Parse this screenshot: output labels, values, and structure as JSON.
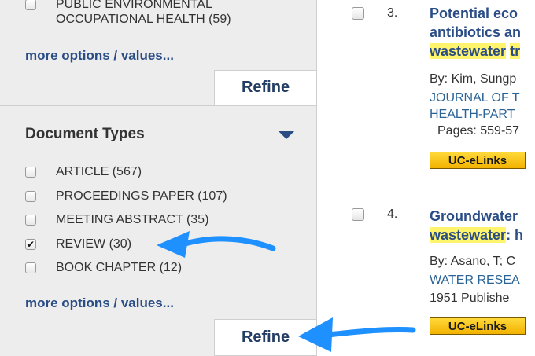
{
  "sidebar": {
    "prev_facet_item": {
      "label": "PUBLIC ENVIRONMENTAL\nOCCUPATIONAL HEALTH (59)"
    },
    "prev_more_options": "more options / values...",
    "prev_refine": "Refine",
    "doc_types": {
      "heading": "Document Types",
      "items": [
        {
          "label": "ARTICLE (567)",
          "checked": false
        },
        {
          "label": "PROCEEDINGS PAPER (107)",
          "checked": false
        },
        {
          "label": "MEETING ABSTRACT (35)",
          "checked": false
        },
        {
          "label": "REVIEW (30)",
          "checked": true
        },
        {
          "label": "BOOK CHAPTER (12)",
          "checked": false
        }
      ],
      "more_options": "more options / values...",
      "refine": "Refine"
    }
  },
  "results": [
    {
      "number": "3.",
      "title_lines": [
        "Potential eco",
        "antibiotics an",
        "wastewater",
        "tr"
      ],
      "by": "By: Kim, Sungp",
      "journal_lines": [
        "JOURNAL OF T",
        "HEALTH-PART"
      ],
      "pages": "Pages: 559-57",
      "link": "UC-eLinks"
    },
    {
      "number": "4.",
      "title_lines": [
        "Groundwater",
        "wastewater",
        ": h"
      ],
      "by": "By: Asano, T; C",
      "journal": "WATER RESEA",
      "year_line": "1951   Publishe",
      "link": "UC-eLinks"
    }
  ],
  "colors": {
    "accent": "#2a4d86",
    "highlight": "#fff46b",
    "arrow": "#1e90ff",
    "button_gold": "#f2b200"
  }
}
